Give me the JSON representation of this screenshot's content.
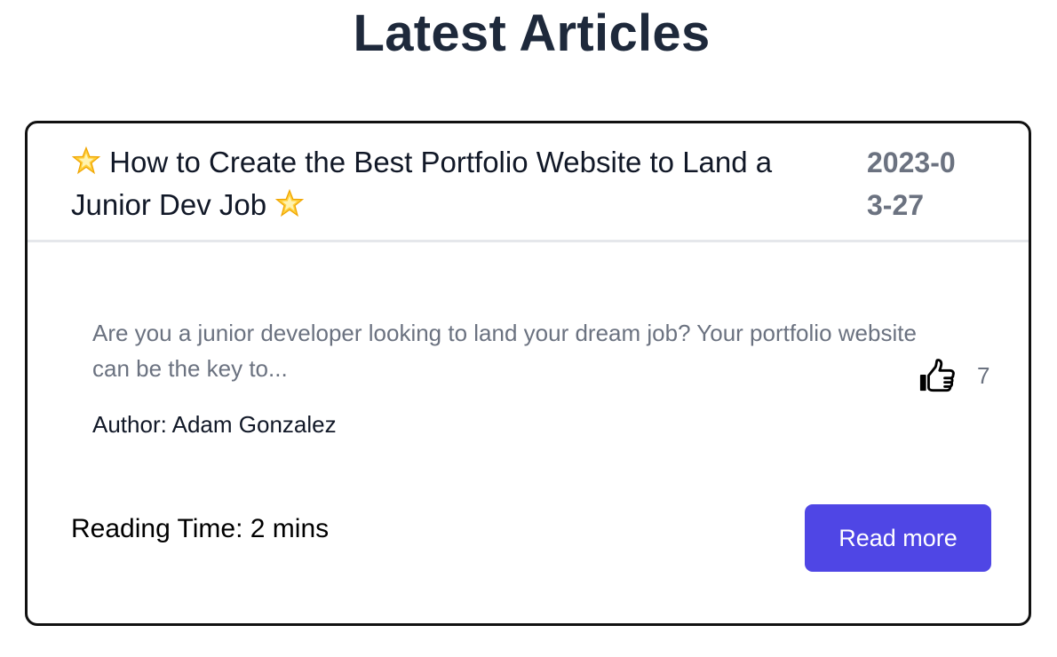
{
  "page": {
    "title": "Latest Articles"
  },
  "article": {
    "title_icon": "glowing-star-icon",
    "title": "How to Create the Best Portfolio Website to Land a Junior Dev Job",
    "date": "2023-03-27",
    "excerpt": "Are you a junior developer looking to land your dream job? Your portfolio website can be the key to...",
    "author": "Author: Adam Gonzalez",
    "likes": "7",
    "like_icon": "thumbs-up-icon",
    "reading_time": "Reading Time: 2 mins",
    "read_more_label": "Read more"
  },
  "colors": {
    "accent": "#4f46e5",
    "heading": "#1e293b",
    "muted": "#6b7280",
    "card_border": "#111111",
    "divider": "#e5e7eb"
  }
}
